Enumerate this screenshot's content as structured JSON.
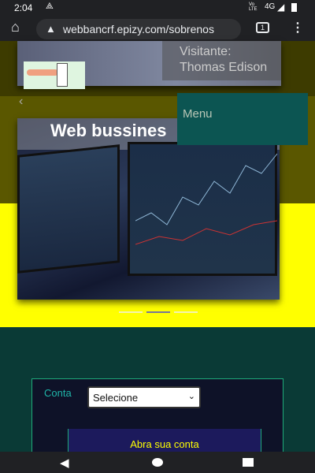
{
  "status_bar": {
    "time": "2:04",
    "network": "4G",
    "volte": "Vo LTE"
  },
  "browser": {
    "url": "webbancrf.epizy.com/sobrenos",
    "tab_count": "1"
  },
  "header": {
    "visitor_label": "Visitante:",
    "visitor_name": "Thomas Edison"
  },
  "menu": {
    "label": "Menu"
  },
  "carousel": {
    "title": "Web bussines",
    "slide_count": 3,
    "active_slide": 2
  },
  "form": {
    "conta_label": "Conta",
    "select_value": "Selecione",
    "open_account_button": "Abra sua conta"
  },
  "colors": {
    "yellow": "#ffff00",
    "teal": "#0c5552",
    "form_bg": "#0e1228",
    "accent_text": "#1fb5a8"
  }
}
